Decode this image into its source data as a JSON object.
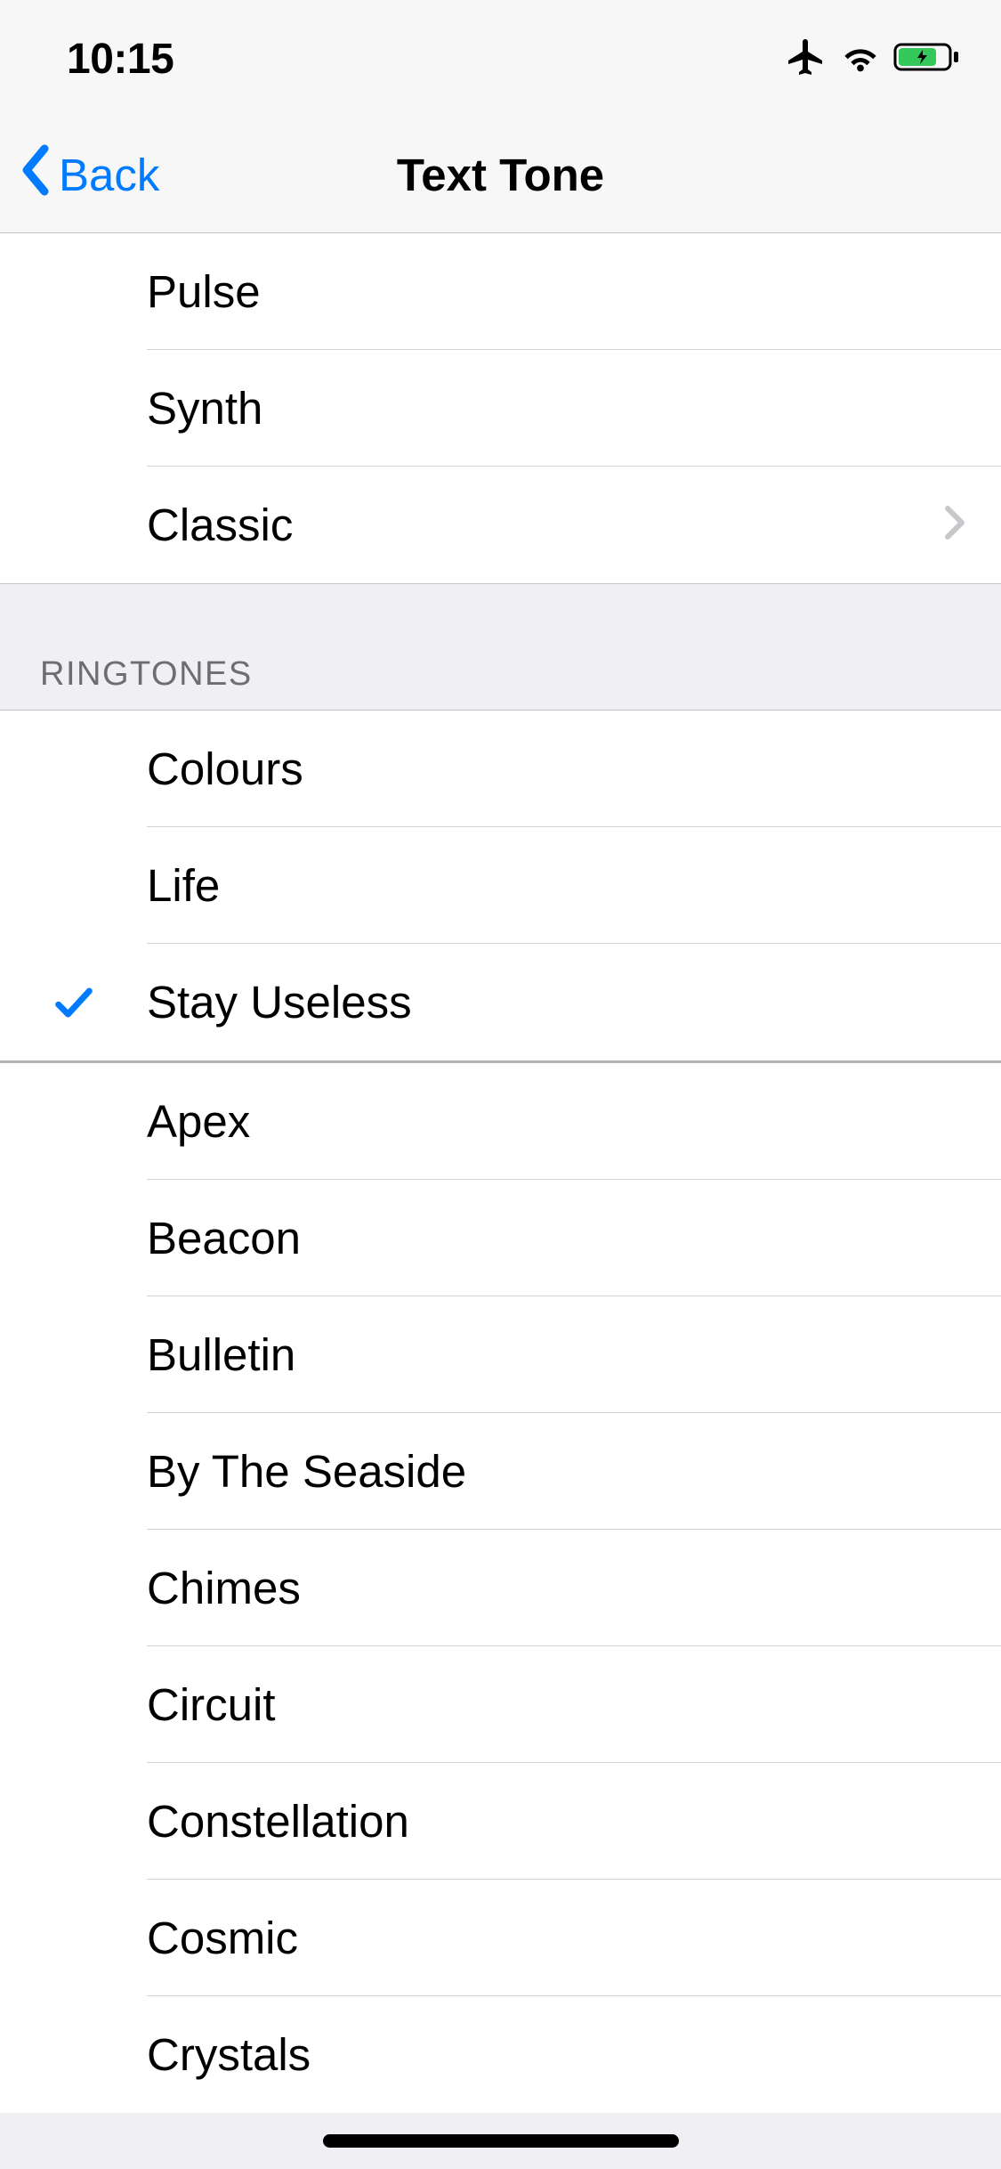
{
  "status": {
    "time": "10:15"
  },
  "nav": {
    "back_label": "Back",
    "title": "Text Tone"
  },
  "alert_tones": [
    {
      "label": "Pulse",
      "selected": false,
      "has_disclosure": false
    },
    {
      "label": "Synth",
      "selected": false,
      "has_disclosure": false
    },
    {
      "label": "Classic",
      "selected": false,
      "has_disclosure": true
    }
  ],
  "ringtones_header": "RINGTONES",
  "ringtones_custom": [
    {
      "label": "Colours",
      "selected": false
    },
    {
      "label": "Life",
      "selected": false
    },
    {
      "label": "Stay Useless",
      "selected": true
    }
  ],
  "ringtones_system": [
    {
      "label": "Apex",
      "selected": false
    },
    {
      "label": "Beacon",
      "selected": false
    },
    {
      "label": "Bulletin",
      "selected": false
    },
    {
      "label": "By The Seaside",
      "selected": false
    },
    {
      "label": "Chimes",
      "selected": false
    },
    {
      "label": "Circuit",
      "selected": false
    },
    {
      "label": "Constellation",
      "selected": false
    },
    {
      "label": "Cosmic",
      "selected": false
    },
    {
      "label": "Crystals",
      "selected": false
    }
  ]
}
